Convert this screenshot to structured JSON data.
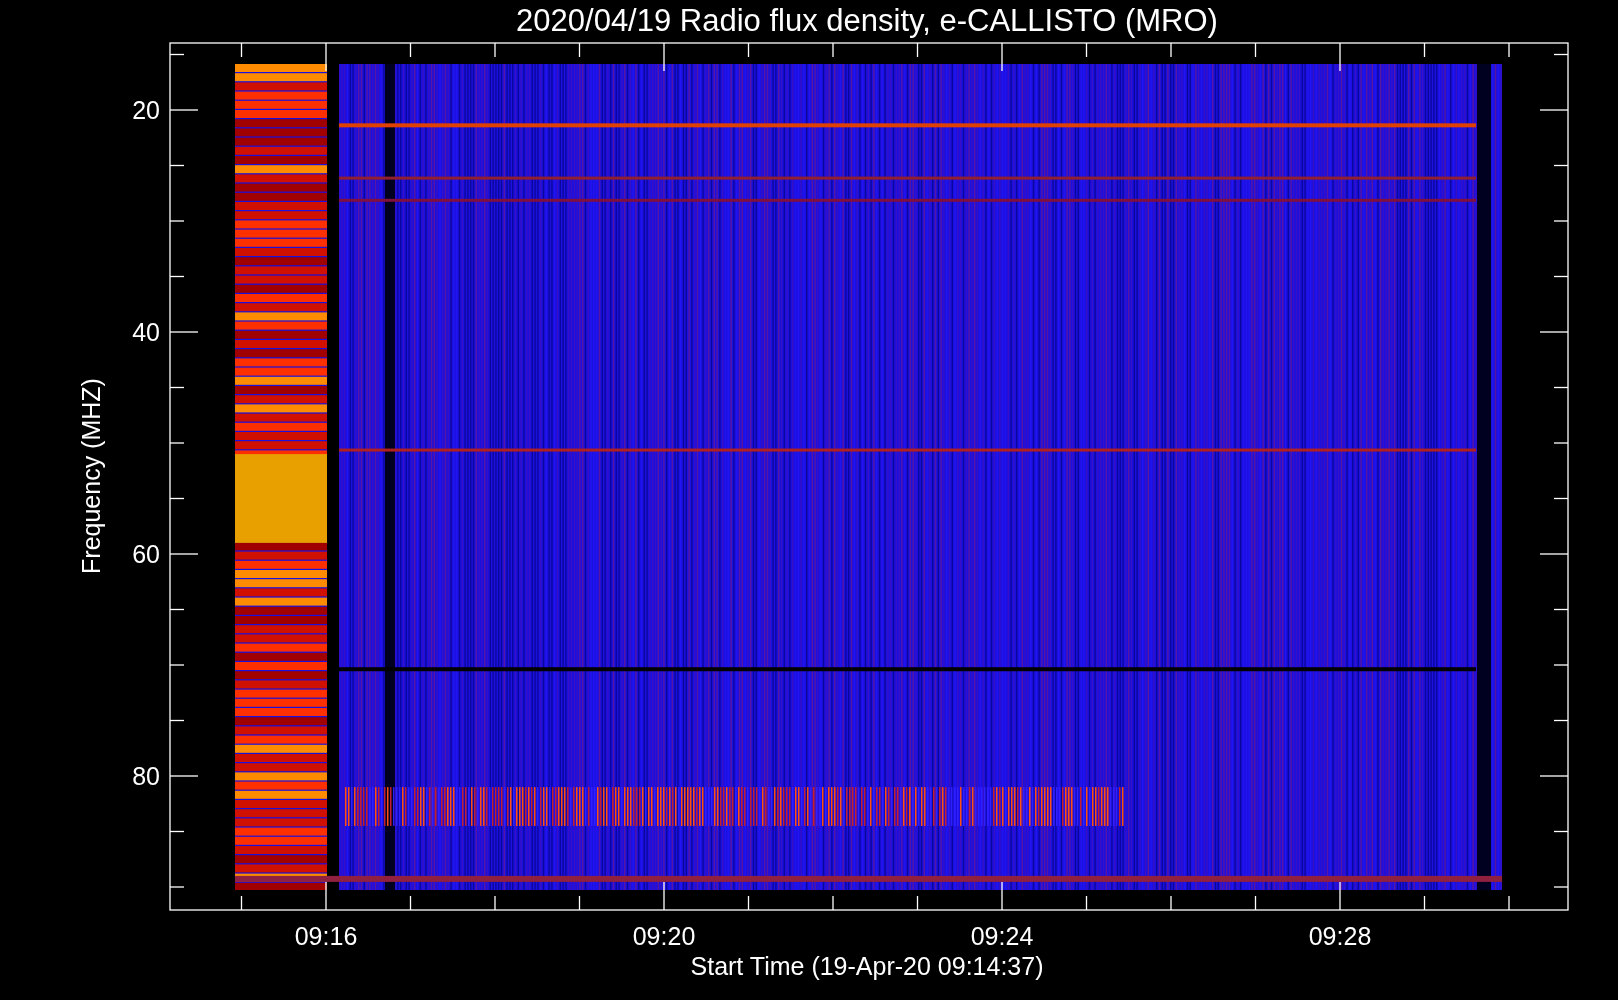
{
  "chart": {
    "title": "2020/04/19  Radio flux density, e-CALLISTO (MRO)",
    "y_axis": {
      "label": "Frequency (MHZ)",
      "tick_labels": [
        "20",
        "40",
        "60",
        "80"
      ]
    },
    "x_axis": {
      "label": "Start Time (19-Apr-20 09:14:37)",
      "tick_labels": [
        "09:16",
        "09:20",
        "09:24",
        "09:28"
      ]
    }
  }
}
